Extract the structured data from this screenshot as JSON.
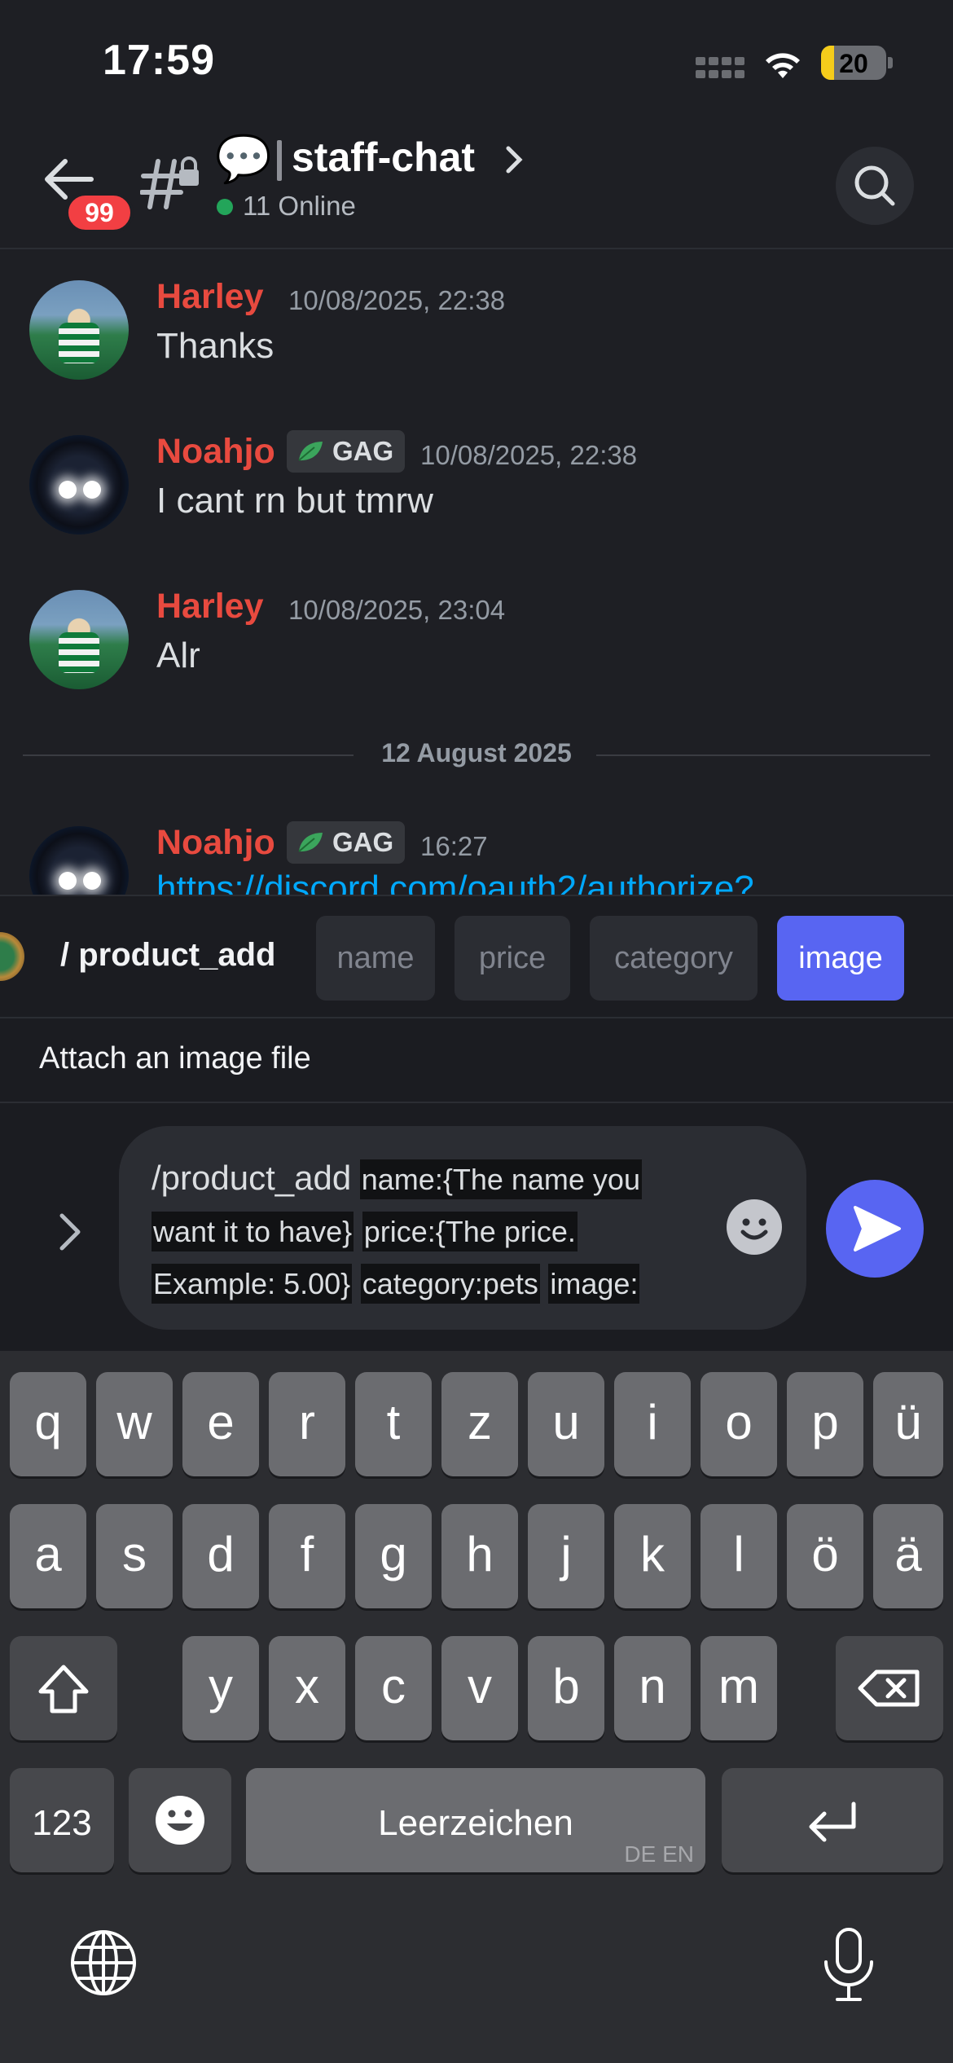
{
  "status_bar": {
    "time": "17:59",
    "battery": "20",
    "battery_level_pct": 20,
    "wifi_icon": "wifi-icon",
    "signal_icon": "cellular-signal-icon"
  },
  "header": {
    "unread_badge": "99",
    "channel_emoji": "💬",
    "channel_name": "staff-chat",
    "online": "11 Online"
  },
  "messages": [
    {
      "author": "Harley",
      "time": "10/08/2025, 22:38",
      "text": "Thanks"
    },
    {
      "author": "Noahjo",
      "tag": "GAG",
      "time": "10/08/2025, 22:38",
      "text": "I cant rn but tmrw"
    },
    {
      "author": "Harley",
      "time": "10/08/2025, 23:04",
      "text": "Alr"
    },
    {
      "author": "Noahjo",
      "tag": "GAG",
      "time": "16:27",
      "text": "https://discord.com/oauth2/authorize?"
    }
  ],
  "date_divider": "12 August 2025",
  "command": {
    "name": "/ product_add",
    "options": [
      "name",
      "price",
      "category",
      "image"
    ],
    "active_option": "image",
    "hint": "Attach an image file"
  },
  "composer": {
    "command": "/product_add",
    "chip_name": "name:{The name you",
    "chip_name2": "want it to have}",
    "chip_price": "price:{The price.",
    "chip_price2": "Example: 5.00}",
    "chip_category": "category:pets",
    "chip_image": "image:"
  },
  "keyboard": {
    "row1": [
      "q",
      "w",
      "e",
      "r",
      "t",
      "z",
      "u",
      "i",
      "o",
      "p",
      "ü"
    ],
    "row2": [
      "a",
      "s",
      "d",
      "f",
      "g",
      "h",
      "j",
      "k",
      "l",
      "ö",
      "ä"
    ],
    "row3": [
      "y",
      "x",
      "c",
      "v",
      "b",
      "n",
      "m"
    ],
    "numbers": "123",
    "space": "Leerzeichen",
    "languages": "DE EN"
  },
  "colors": {
    "accent": "#5865f2",
    "username": "#e84a3f",
    "link": "#00a8fc",
    "online": "#23a55a",
    "badge": "#f23f43"
  }
}
